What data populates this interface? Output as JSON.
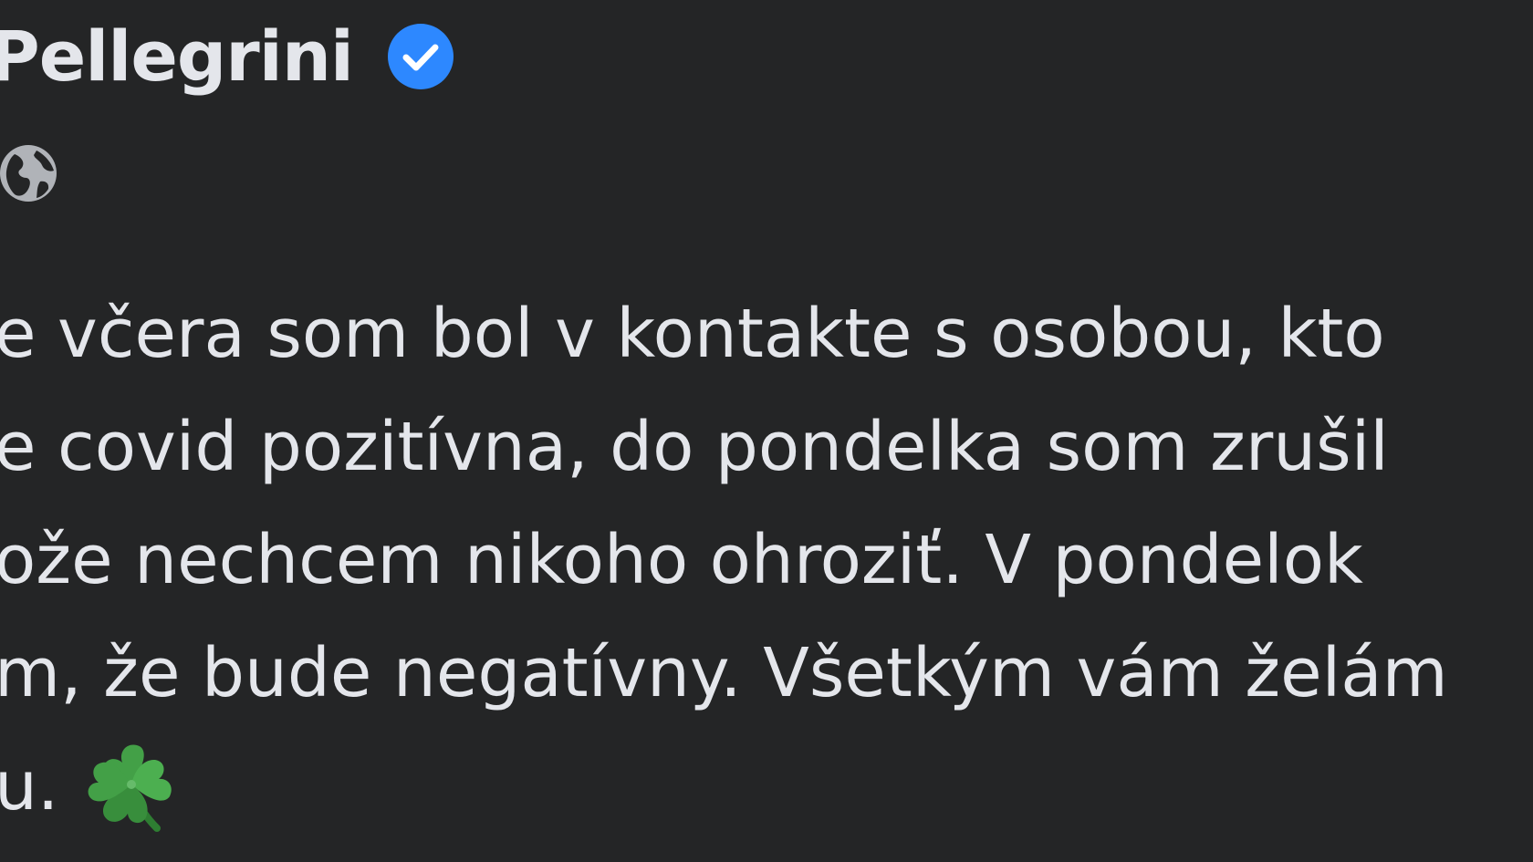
{
  "post": {
    "author_name": "Pellegrini",
    "verified_icon": "verified-badge-icon",
    "audience_icon": "globe-icon",
    "body_lines": [
      "e včera som bol v kontakte s osobou, kto",
      "e covid pozitívna, do pondelka som zrušil",
      "ože nechcem nikoho ohroziť. V pondelok",
      "m, že bude negatívny. Všetkým vám želám",
      "u. "
    ],
    "emoji_icon": "four-leaf-clover-icon",
    "colors": {
      "background": "#242526",
      "text": "#e4e6eb",
      "verified": "#2d88ff",
      "clover": "#43a047"
    }
  }
}
